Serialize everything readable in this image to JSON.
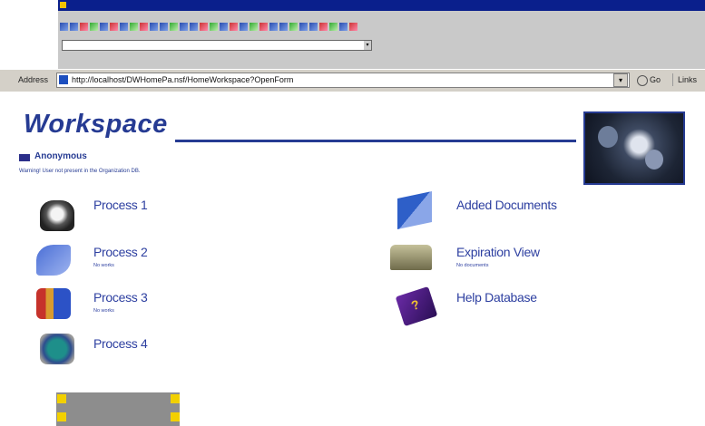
{
  "address_bar": {
    "label": "Address",
    "url": "http://localhost/DWHomePa.nsf/HomeWorkspace?OpenForm",
    "go_label": "Go",
    "links_label": "Links"
  },
  "page": {
    "title": "Workspace",
    "user_name": "Anonymous",
    "warning": "Warning! User not present in the Organization DB."
  },
  "left_items": [
    {
      "label": "Process 1",
      "sub": "",
      "icon": "process-1-icon"
    },
    {
      "label": "Process 2",
      "sub": "No works",
      "icon": "process-2-icon"
    },
    {
      "label": "Process 3",
      "sub": "No works",
      "icon": "process-3-icon"
    },
    {
      "label": "Process 4",
      "sub": "",
      "icon": "process-4-icon"
    }
  ],
  "right_items": [
    {
      "label": "Added Documents",
      "sub": "",
      "icon": "added-documents-icon"
    },
    {
      "label": "Expiration View",
      "sub": "No documents",
      "icon": "expiration-view-icon"
    },
    {
      "label": "Help Database",
      "sub": "",
      "icon": "help-database-icon"
    }
  ],
  "colors": {
    "accent": "#263b93",
    "link": "#2d3fa0",
    "chrome": "#d4d0c8"
  }
}
